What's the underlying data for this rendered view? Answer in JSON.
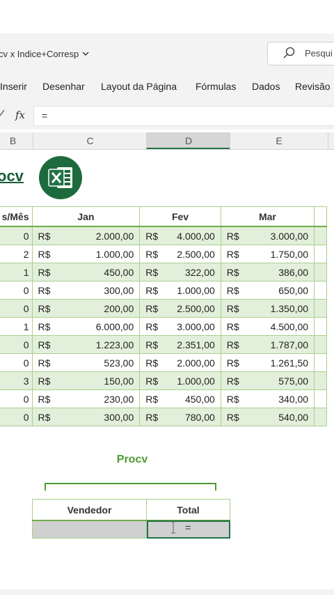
{
  "titlebar": {
    "doc_title": "cv x Indice+Corresp",
    "doc_title_chevron": "chevron-down-icon",
    "search_placeholder": "Pesqui"
  },
  "ribbon": {
    "tabs": [
      "Inserir",
      "Desenhar",
      "Layout da Página",
      "Fórmulas",
      "Dados",
      "Revisão"
    ]
  },
  "formula_bar": {
    "fx_label": "fx",
    "value": "="
  },
  "columns": [
    "B",
    "C",
    "D",
    "E"
  ],
  "sheet": {
    "title": "ocv",
    "table_headers": [
      "s/Mês",
      "Jan",
      "Fev",
      "Mar"
    ],
    "currency": "R$",
    "rows": [
      {
        "id": "0",
        "jan": "2.000,00",
        "fev": "4.000,00",
        "mar": "3.000,00"
      },
      {
        "id": "2",
        "jan": "1.000,00",
        "fev": "2.500,00",
        "mar": "1.750,00"
      },
      {
        "id": "1",
        "jan": "450,00",
        "fev": "322,00",
        "mar": "386,00"
      },
      {
        "id": "0",
        "jan": "300,00",
        "fev": "1.000,00",
        "mar": "650,00"
      },
      {
        "id": "0",
        "jan": "200,00",
        "fev": "2.500,00",
        "mar": "1.350,00"
      },
      {
        "id": "1",
        "jan": "6.000,00",
        "fev": "3.000,00",
        "mar": "4.500,00"
      },
      {
        "id": "0",
        "jan": "1.223,00",
        "fev": "2.351,00",
        "mar": "1.787,00"
      },
      {
        "id": "0",
        "jan": "523,00",
        "fev": "2.000,00",
        "mar": "1.261,50"
      },
      {
        "id": "3",
        "jan": "150,00",
        "fev": "1.000,00",
        "mar": "575,00"
      },
      {
        "id": "0",
        "jan": "230,00",
        "fev": "450,00",
        "mar": "340,00"
      },
      {
        "id": "0",
        "jan": "300,00",
        "fev": "780,00",
        "mar": "540,00"
      }
    ],
    "procv_label": "Procv",
    "lookup_headers": [
      "Vendedor",
      "Total"
    ],
    "active_cell_value": "="
  },
  "colors": {
    "accent_green": "#217346",
    "band_green": "#e2efda",
    "header_underline": "#70ad47",
    "procv_green": "#4e9a33"
  }
}
